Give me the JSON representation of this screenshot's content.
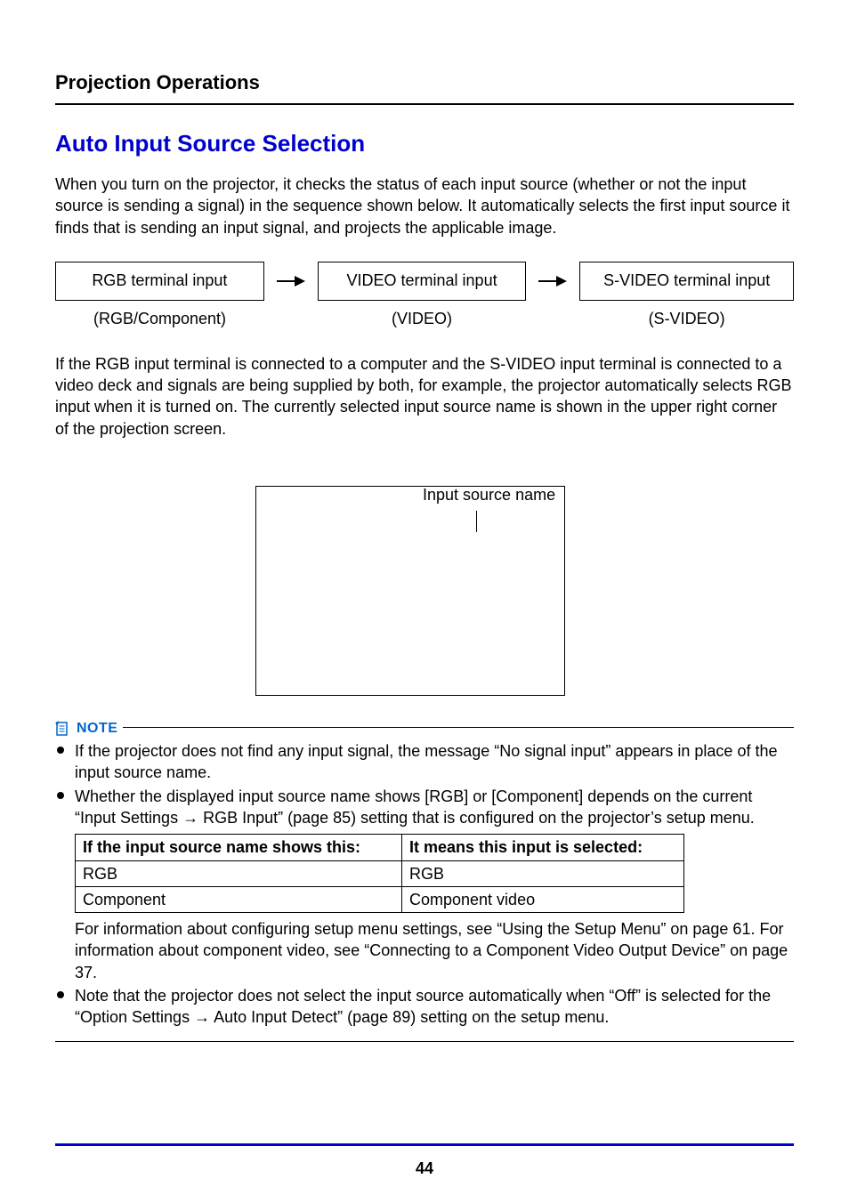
{
  "section_heading": "Projection Operations",
  "title": "Auto Input Source Selection",
  "intro": "When you turn on the projector, it checks the status of each input source (whether or not the input source is sending a signal) in the sequence shown below. It automatically selects the first input source it finds that is sending an input signal, and projects the applicable image.",
  "flow": {
    "boxes": [
      "RGB terminal input",
      "VIDEO terminal input",
      "S-VIDEO terminal input"
    ],
    "subs": [
      "(RGB/Component)",
      "(VIDEO)",
      "(S-VIDEO)"
    ]
  },
  "after_flow": "If the RGB input terminal is connected to a computer and the S-VIDEO input terminal is connected to a video deck and signals are being supplied by both, for example, the projector automatically selects RGB input when it is turned on. The currently selected input source name is shown in the upper right corner of the projection screen.",
  "diagram_caption": "Input source name",
  "note_label": "NOTE",
  "notes": {
    "b1": "If the projector does not find any input signal, the message “No signal input” appears in place of the input source name.",
    "b2": "Whether the displayed input source name shows [RGB] or [Component] depends on the current “Input Settings → RGB Input” (page 85) setting that is configured on the projector’s setup menu.",
    "table": {
      "head": [
        "If the input source name shows this:",
        "It means this input is selected:"
      ],
      "rows": [
        [
          "RGB",
          "RGB"
        ],
        [
          "Component",
          "Component video"
        ]
      ]
    },
    "b2_after": "For information about configuring setup menu settings, see “Using the Setup Menu” on page 61. For information about component video, see “Connecting to a Component Video Output Device” on page 37.",
    "b3": "Note that the projector does not select the input source automatically when “Off” is selected for the “Option Settings → Auto Input Detect” (page 89) setting on the setup menu."
  },
  "page_number": "44"
}
